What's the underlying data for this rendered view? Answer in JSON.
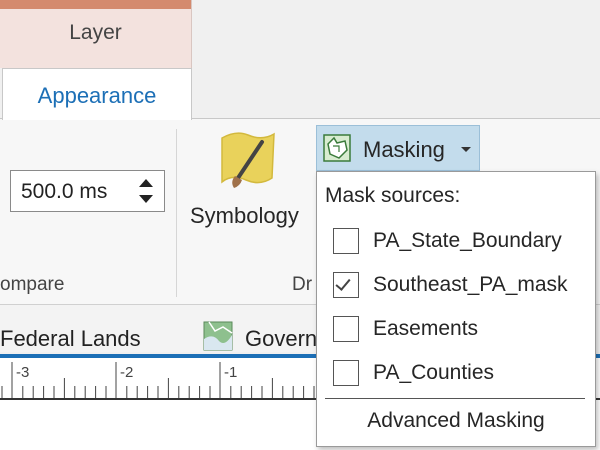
{
  "tabs": {
    "layer": "Layer",
    "appearance": "Appearance"
  },
  "ribbon": {
    "swipe_duration": "500.0  ms",
    "compare_group_label": "ompare",
    "symbology_label": "Symbology",
    "drawing_group_label": "Dr",
    "masking_label": "Masking"
  },
  "masking_menu": {
    "heading": "Mask sources:",
    "items": [
      {
        "label": "PA_State_Boundary",
        "checked": false
      },
      {
        "label": "Southeast_PA_mask",
        "checked": true
      },
      {
        "label": "Easements",
        "checked": false
      },
      {
        "label": "PA_Counties",
        "checked": false
      }
    ],
    "advanced": "Advanced Masking"
  },
  "layers_strip": {
    "federal_lands": "Federal Lands",
    "government": "Govern"
  },
  "ruler": {
    "labels": [
      "-3",
      "-2",
      "-1"
    ]
  },
  "colors": {
    "accent_blue": "#1c6fb6",
    "layer_tab_stripe": "#d48a6e",
    "masking_highlight": "#c3dcec"
  }
}
